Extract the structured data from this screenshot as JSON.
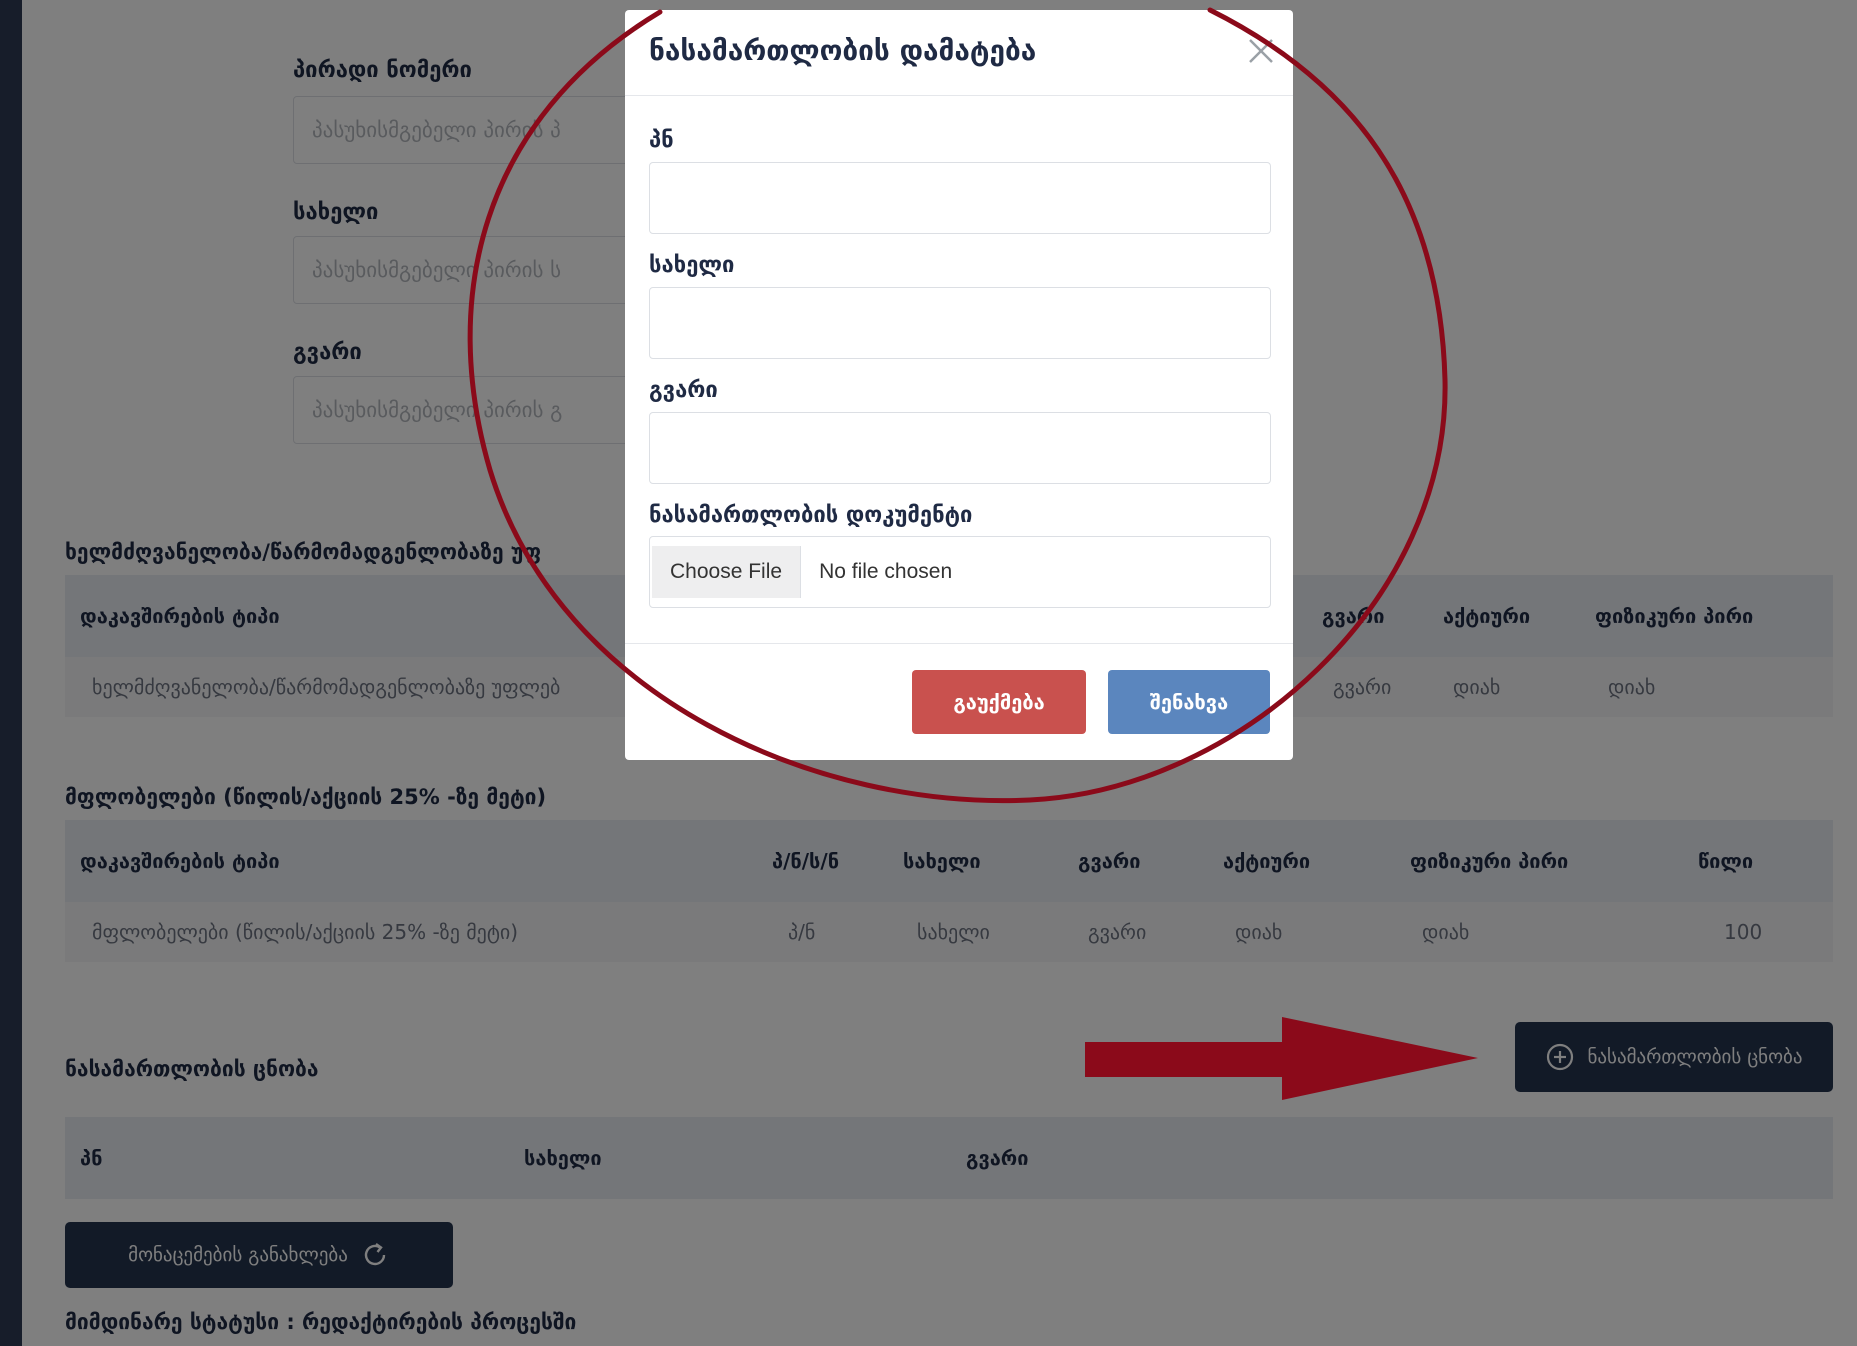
{
  "form": {
    "id_label": "პირადი ნომერი",
    "id_placeholder": "პასუხისმგებელი პირის პ",
    "name_label": "სახელი",
    "name_placeholder": "პასუხისმგებელი პირის ს",
    "surname_label": "გვარი",
    "surname_placeholder": "პასუხისმგებელი პირის გ"
  },
  "management": {
    "title": "ხელმძღვანელობა/წარმომადგენლობაზე უფ",
    "headers": [
      "დაკავშირების ტიპი",
      "გვარი",
      "აქტიური",
      "ფიზიკური პირი"
    ],
    "row": [
      "ხელმძღვანელობა/წარმომადგენლობაზე უფლებ",
      "გვარი",
      "დიახ",
      "დიახ"
    ]
  },
  "owners": {
    "title": "მფლობელები (წილის/აქციის 25% -ზე მეტი)",
    "headers": [
      "დაკავშირების ტიპი",
      "პ/ნ/ს/ნ",
      "სახელი",
      "გვარი",
      "აქტიური",
      "ფიზიკური პირი",
      "წილი"
    ],
    "row": [
      "მფლობელები (წილის/აქციის 25% -ზე მეტი)",
      "პ/ნ",
      "სახელი",
      "გვარი",
      "დიახ",
      "დიახ",
      "100"
    ]
  },
  "conviction": {
    "title": "ნასამართლობის ცნობა",
    "add_button": "ნასამართლობის ცნობა",
    "headers": [
      "პნ",
      "სახელი",
      "გვარი"
    ]
  },
  "refresh_button": "მონაცემების განახლება",
  "status": "მიმდინარე სტატუსი : რედაქტირების პროცესში",
  "modal": {
    "title": "ნასამართლობის დამატება",
    "pn_label": "პნ",
    "name_label": "სახელი",
    "surname_label": "გვარი",
    "doc_label": "ნასამართლობის დოკუმენტი",
    "choose_file": "Choose File",
    "no_file": "No file chosen",
    "cancel": "გაუქმება",
    "save": "შენახვა"
  },
  "colors": {
    "annotation_red": "#8b0a1a",
    "primary_dark": "#24344f",
    "cancel_red": "#c9514e",
    "save_blue": "#5b86be"
  },
  "icons": [
    "close-icon",
    "plus-circle-icon",
    "refresh-icon"
  ]
}
